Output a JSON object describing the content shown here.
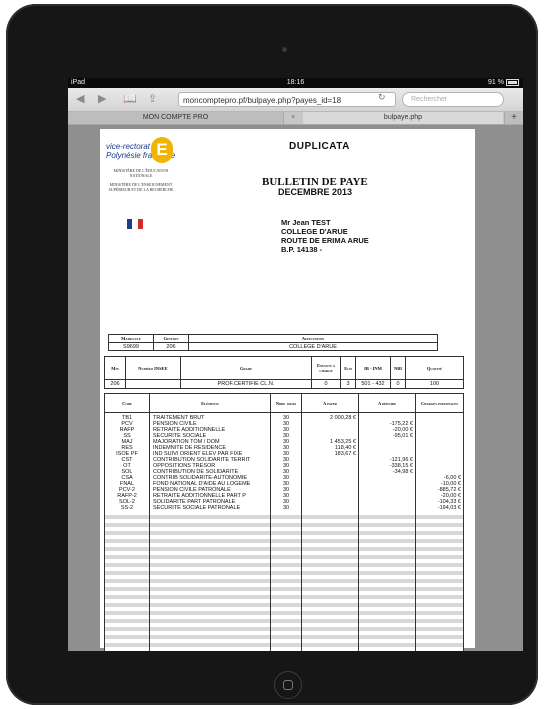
{
  "status_bar": {
    "device": "iPad",
    "time": "18:16",
    "battery": "91 %"
  },
  "browser": {
    "url": "moncomptepro.pf/bulpaye.php?payes_id=18",
    "search_placeholder": "Rechercher",
    "tabs": [
      "MON COMPTE PRO",
      "bulpaye.php"
    ],
    "close_tab": "×",
    "new_tab": "+"
  },
  "document": {
    "logo_line1": "vice-rectorat",
    "logo_line2": "Polynésie française",
    "logo_letter": "E",
    "ministry1": "MINISTÈRE DE L'ÉDUCATION NATIONALE",
    "ministry2": "MINISTÈRE DE L'ENSEIGNEMENT SUPÉRIEUR ET DE LA RECHERCHE",
    "duplicata": "DUPLICATA",
    "title": "BULLETIN DE PAYE",
    "period": "DECEMBRE 2013",
    "address": [
      "Mr Jean TEST",
      "COLLEGE D'ARUE",
      "ROUTE DE ERIMA  ARUE",
      "B.P. 14138 -"
    ]
  },
  "info_table": {
    "headers": [
      "Matricule",
      "Gestion",
      "Affectation"
    ],
    "values": [
      "S9699",
      "206",
      "COLLEGE D'ARUE"
    ]
  },
  "grade_table": {
    "headers": [
      "Min",
      "Numéro INSEE",
      "Grade",
      "Enfants à charge",
      "Ech",
      "IB - INM",
      "NBI",
      "Quotité"
    ],
    "values": [
      "206",
      "",
      "PROF.CERTIFIE CL.N.",
      "0",
      "3",
      "501 - 432",
      "0",
      "100"
    ]
  },
  "lines_table": {
    "headers": [
      "Code",
      "Eléments",
      "Nbre jours",
      "A payer",
      "A déduire",
      "Charges patronales"
    ],
    "rows": [
      {
        "code": "TB1",
        "element": "TRAITEMENT BRUT",
        "jours": "30",
        "payer": "2 000,28 €",
        "deduire": "",
        "charges": ""
      },
      {
        "code": "PCV",
        "element": "PENSION CIVILE",
        "jours": "30",
        "payer": "",
        "deduire": "-175,22 €",
        "charges": ""
      },
      {
        "code": "RAFP",
        "element": "RETRAITE ADDITIONNELLE",
        "jours": "30",
        "payer": "",
        "deduire": "-20,00 €",
        "charges": ""
      },
      {
        "code": "SS",
        "element": "SECURITE SOCIALE",
        "jours": "30",
        "payer": "",
        "deduire": "-95,01 €",
        "charges": ""
      },
      {
        "code": "MAJ",
        "element": "MAJORATION TOM / DOM",
        "jours": "30",
        "payer": "1 453,25 €",
        "deduire": "",
        "charges": ""
      },
      {
        "code": "RES",
        "element": "INDEMNITE DE RESIDENCE",
        "jours": "30",
        "payer": "118,40 €",
        "deduire": "",
        "charges": ""
      },
      {
        "code": "ISOE PF",
        "element": "IND SUIVI ORIENT ELEV PAR FIXE",
        "jours": "30",
        "payer": "183,67 €",
        "deduire": "",
        "charges": ""
      },
      {
        "code": "CST",
        "element": "CONTRIBUTION SOLIDARITE TERRIT",
        "jours": "30",
        "payer": "",
        "deduire": "-121,96 €",
        "charges": ""
      },
      {
        "code": "OT",
        "element": "OPPOSITIONS TRESOR",
        "jours": "30",
        "payer": "",
        "deduire": "-338,15 €",
        "charges": ""
      },
      {
        "code": "SOL",
        "element": "CONTRIBUTION DE SOLIDARITE",
        "jours": "30",
        "payer": "",
        "deduire": "-34,98 €",
        "charges": ""
      },
      {
        "code": "",
        "element": "",
        "jours": "",
        "payer": "",
        "deduire": "",
        "charges": ""
      },
      {
        "code": "CSA",
        "element": "CONTRIB SOLIDARITE-AUTONOMIE",
        "jours": "30",
        "payer": "",
        "deduire": "",
        "charges": "-6,00 €"
      },
      {
        "code": "FNAL",
        "element": "FOND NATIONAL D'AIDE AU LOGEME",
        "jours": "30",
        "payer": "",
        "deduire": "",
        "charges": "-10,00 €"
      },
      {
        "code": "PCV-2",
        "element": "PENSION CIVILE PATRONALE",
        "jours": "30",
        "payer": "",
        "deduire": "",
        "charges": "-885,72 €"
      },
      {
        "code": "RAFP-2",
        "element": "RETRAITE ADDITIONNELLE PART P",
        "jours": "30",
        "payer": "",
        "deduire": "",
        "charges": "-20,00 €"
      },
      {
        "code": "SOL-2",
        "element": "SOLIDARITE PART PATRONALE",
        "jours": "30",
        "payer": "",
        "deduire": "",
        "charges": "-104,33 €"
      },
      {
        "code": "SS-2",
        "element": "SECURITE SOCIALE PATRONALE",
        "jours": "30",
        "payer": "",
        "deduire": "",
        "charges": "-194,03 €"
      }
    ]
  }
}
